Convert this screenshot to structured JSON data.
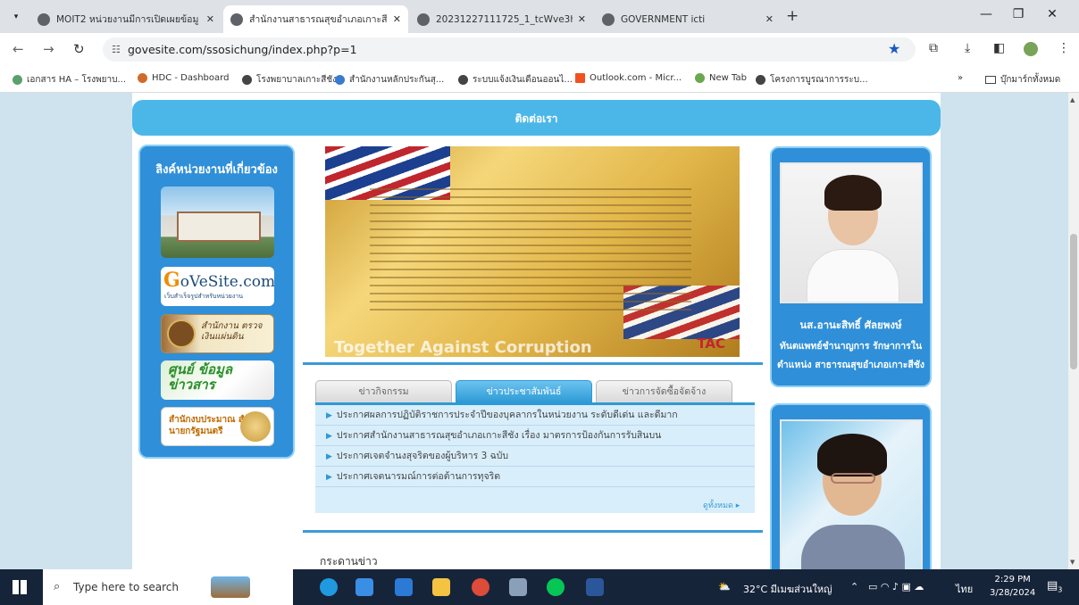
{
  "browser": {
    "tabs": [
      {
        "title": "MOIT2 หน่วยงานมีการเปิดเผยข้อมู"
      },
      {
        "title": "สำนักงานสาธารณสุขอำเภอเกาะสีชัง"
      },
      {
        "title": "20231227111725_1_tcWve3h.p"
      },
      {
        "title": "GOVERNMENT icti"
      }
    ],
    "new_tab_label": "+",
    "url": "govesite.com/ssosichung/index.php?p=1",
    "bookmarks": [
      {
        "label": "เอกสาร HA – โรงพยาบ..."
      },
      {
        "label": "HDC - Dashboard"
      },
      {
        "label": "โรงพยาบาลเกาะสีชัง"
      },
      {
        "label": "สำนักงานหลักประกันสุ..."
      },
      {
        "label": "ระบบแจ้งเงินเดือนออนไ..."
      },
      {
        "label": "Outlook.com - Micr..."
      },
      {
        "label": "New Tab"
      },
      {
        "label": "โครงการบูรณาการระบ..."
      }
    ],
    "bookmarks_overflow": "»",
    "all_bookmarks": "บุ๊กมาร์กทั้งหมด"
  },
  "site": {
    "contact": "ติดต่อเรา",
    "left_sidebar": {
      "heading": "ลิงค์หน่วยงานที่เกี่ยวข้อง",
      "links": {
        "gove_main": "oVeSite.com",
        "gove_letter": "G",
        "gove_sub": "เว็บสำเร็จรูปสำหรับหน่วยงาน",
        "audit": "สำนักงาน ตรวจเงินแผ่นดิน",
        "info": "ศูนย์ ข้อมูลข่าวสาร",
        "budget": "สำนักงบประมาณ สำนักนายกรัฐมนตรี"
      }
    },
    "banner": {
      "tag": "Together Against Corruption",
      "logo": "TAC"
    },
    "news_tabs": [
      "ข่าวกิจกรรม",
      "ข่าวประชาสัมพันธ์",
      "ข่าวการจัดซื้อจัดจ้าง"
    ],
    "news_items": [
      "ประกาศผลการปฏิบัติราชการประจำปีของบุคลากรในหน่วยงาน ระดับดีเด่น และดีมาก",
      "ประกาศสำนักงานสาธารณสุขอำเภอเกาะสีชัง เรื่อง มาตรการป้องกันการรับสินบน",
      "ประกาศเจตจำนงสุจริตของผู้บริหาร 3 ฉบับ",
      "ประกาศเจตนารมณ์การต่อต้านการทุจริต"
    ],
    "see_all": "ดูทั้งหมด",
    "board_heading": "กระดานข่าว",
    "officer1": {
      "name": "นส.อานะสิทธิ์ ศัลยพงษ์",
      "position_line1": "ทันตแพทย์ชำนาญการ รักษาการใน",
      "position_line2": "ตำแหน่ง สาธารณสุขอำเภอเกาะสีชัง"
    }
  },
  "taskbar": {
    "search_placeholder": "Type here to search",
    "weather": "32°C มีเมฆส่วนใหญ่",
    "lang": "ไทย",
    "time": "2:29 PM",
    "date": "3/28/2024",
    "notification_count": "3"
  }
}
